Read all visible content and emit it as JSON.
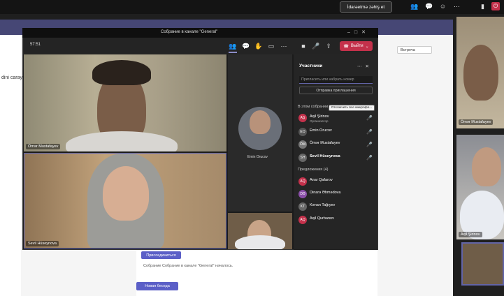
{
  "top_bar": {
    "control_label": "İdarəetmə zəhiş et"
  },
  "background_window": {
    "left_text": "dini carayı",
    "join_button": "Присоединиться",
    "meeting_started": "Собрание Собрание в канале \"General\" началось.",
    "new_chat_button": "Новая беседа",
    "dropdown": "Встреча"
  },
  "meeting_window": {
    "title": "Собрание в канале \"General\"",
    "timer": "57:51",
    "leave_label": "Выйти"
  },
  "tiles": {
    "t1_name": "Ömər Mustafayev",
    "t2_name": "Sevil Hüseynova",
    "t3_name": "Emin Orucov",
    "strip1_name": "Ömər Mustafayev",
    "strip2_name": "Aqil Şirinov"
  },
  "participants": {
    "title": "Участники",
    "invite_placeholder": "Пригласить или набрать номер",
    "share_invite": "Отправка приглашения",
    "in_meeting_label": "В этом собрании (6)",
    "mute_all": "Отключить все микрофо...",
    "in_meeting": [
      {
        "initials": "AŞ",
        "name": "Aqil Şirinov",
        "role": "Организатор",
        "color": "#c4314b"
      },
      {
        "initials": "EO",
        "name": "Emin Orucov",
        "role": "",
        "color": "#555"
      },
      {
        "initials": "ÖM",
        "name": "Ömər Mustafayev",
        "role": "",
        "color": "#777"
      },
      {
        "initials": "SH",
        "name": "Sevil Hüseynova",
        "role": "",
        "color": "#666"
      }
    ],
    "others_label": "Предложения (4)",
    "others": [
      {
        "initials": "AQ",
        "name": "Anar Qafarov",
        "color": "#c4314b"
      },
      {
        "initials": "DƏ",
        "name": "Dinarə Əhmədova",
        "color": "#8a4fa8"
      },
      {
        "initials": "KT",
        "name": "Kənan Tağıyev",
        "color": "#666"
      },
      {
        "initials": "AQ",
        "name": "Aqil Qurbanov",
        "color": "#c4314b"
      }
    ]
  },
  "colors": {
    "accent": "#6264a7",
    "leave_red": "#c4314b"
  }
}
